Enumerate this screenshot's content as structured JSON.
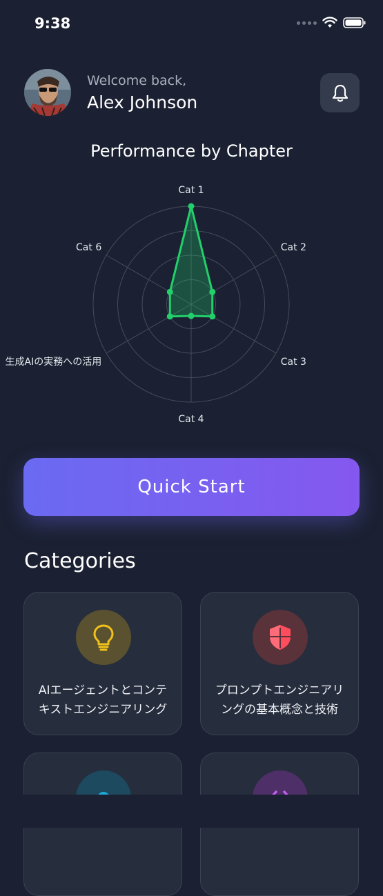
{
  "status_bar": {
    "time": "9:38"
  },
  "header": {
    "welcome": "Welcome back,",
    "name": "Alex Johnson"
  },
  "chart_title": "Performance by Chapter",
  "chart_data": {
    "type": "radar",
    "categories": [
      "Cat 1",
      "Cat 2",
      "Cat 3",
      "Cat 4",
      "生成AIの実務への活用",
      "Cat 6"
    ],
    "values": [
      100,
      25,
      25,
      12,
      25,
      25
    ],
    "rlim": [
      0,
      100
    ],
    "grid": true,
    "color": "#22d06b"
  },
  "quick_start": {
    "label": "Quick Start"
  },
  "categories_section": {
    "title": "Categories",
    "cards": [
      {
        "line1": "AIエージェントとコンテ",
        "line2": "キストエンジニアリング",
        "icon": "lightbulb-icon",
        "color": "#f1c21b",
        "bg": "#5a5131"
      },
      {
        "line1": "プロンプトエンジニアリ",
        "line2": "ングの基本概念と技術",
        "icon": "shield-icon",
        "color": "#ff4d5e",
        "bg": "#5a3239"
      },
      {
        "line1": "",
        "line2": "",
        "icon": "gear-icon",
        "color": "#1fa9d6",
        "bg": "#1d4a5f"
      },
      {
        "line1": "",
        "line2": "",
        "icon": "code-icon",
        "color": "#c25ff0",
        "bg": "#4e2f68"
      }
    ]
  }
}
